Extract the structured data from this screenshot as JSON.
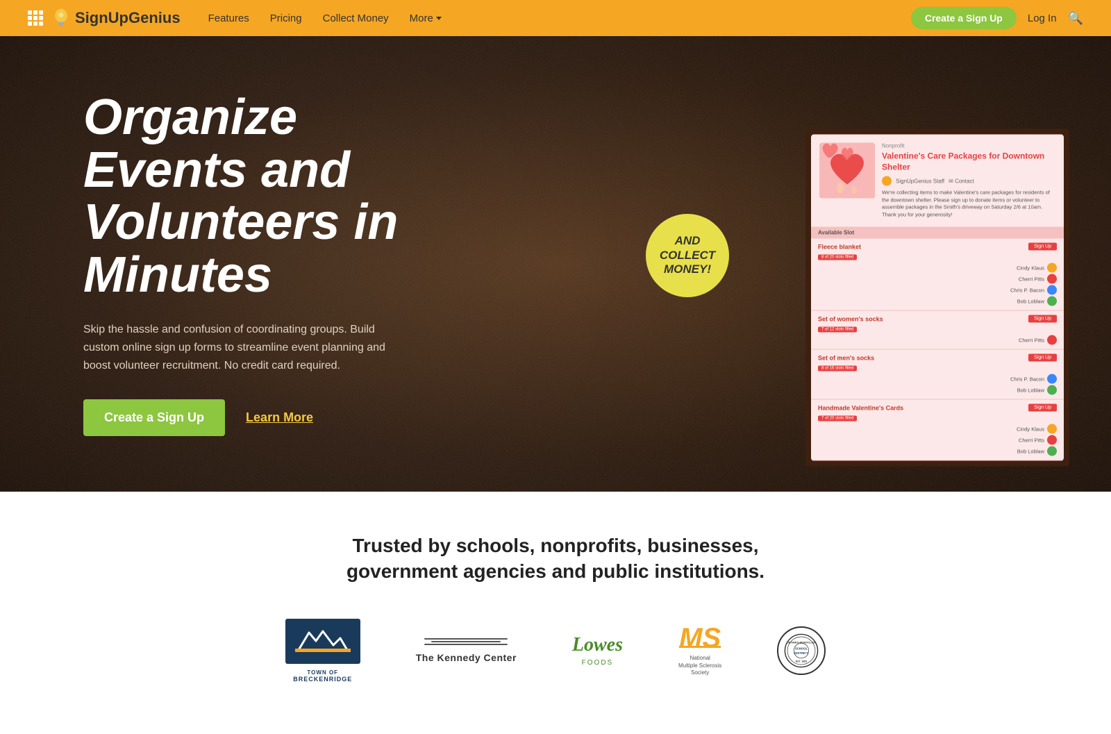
{
  "nav": {
    "logo_text": "SignUpGenius",
    "links": [
      {
        "label": "Features",
        "id": "features"
      },
      {
        "label": "Pricing",
        "id": "pricing"
      },
      {
        "label": "Collect Money",
        "id": "collect-money"
      },
      {
        "label": "More",
        "id": "more"
      }
    ],
    "cta_label": "Create a Sign Up",
    "login_label": "Log In"
  },
  "hero": {
    "title": "Organize Events and Volunteers in Minutes",
    "subtitle": "Skip the hassle and confusion of coordinating groups. Build custom online sign up forms to streamline event planning and boost volunteer recruitment. No credit card required.",
    "cta_label": "Create a Sign Up",
    "learn_more_label": "Learn More",
    "badge_text": "AND COLLECT MONEY!"
  },
  "signup_card": {
    "nonprofit_label": "Nonprofit",
    "title": "Valentine's Care Packages for Downtown Shelter",
    "organizer": "SignUpGenius Staff",
    "contact_label": "Contact",
    "description": "We're collecting items to make Valentine's care packages for residents of the downtown shelter. Please sign up to donate items or volunteer to assemble packages in the Smith's driveway on Saturday 2/6 at 10am. Thank you for your generosity!",
    "slots_header": "Available Slot",
    "slots": [
      {
        "name": "Fleece blanket",
        "filled": "8 of 20 slots filled",
        "people": [
          "Cindy Klaus",
          "Cherri Pitts",
          "Chris P. Bacon",
          "Bob Loblaw"
        ]
      },
      {
        "name": "Set of women's socks",
        "filled": "7 of 12 slots filled",
        "people": [
          "Cherri Pitts"
        ]
      },
      {
        "name": "Set of men's socks",
        "filled": "8 of 16 slots filled",
        "people": [
          "Chris P. Bacon",
          "Bob Loblaw"
        ]
      },
      {
        "name": "Handmade Valentine's Cards",
        "filled": "7 of 20 slots filled",
        "people": [
          "Cindy Klaus",
          "Cherri Pitts",
          "Bob Loblaw"
        ]
      }
    ]
  },
  "trusted": {
    "title": "Trusted by schools, nonprofits, businesses,\ngovernment agencies and public institutions.",
    "logos": [
      {
        "name": "Town of Breckenridge",
        "id": "breckenridge"
      },
      {
        "name": "The Kennedy Center",
        "id": "kennedy"
      },
      {
        "name": "Lowes Foods",
        "id": "lowes"
      },
      {
        "name": "National Multiple Sclerosis Society",
        "id": "ms"
      },
      {
        "name": "Ontario-Montclair School District",
        "id": "ontario"
      }
    ]
  }
}
